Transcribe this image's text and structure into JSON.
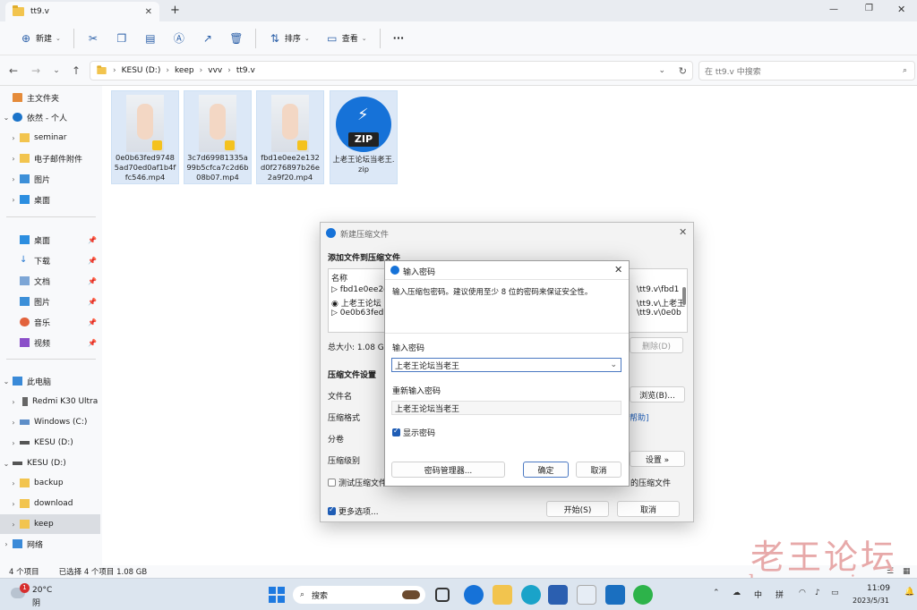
{
  "window": {
    "tab_title": "tt9.v",
    "new_tab": "+",
    "minimize": "—",
    "maximize": "❐",
    "close": "✕"
  },
  "toolbar": {
    "new": "新建",
    "sort": "排序",
    "view": "查看",
    "more": "···"
  },
  "address": {
    "segments": [
      "KESU (D:)",
      "keep",
      "vvv",
      "tt9.v"
    ],
    "search_placeholder": "在 tt9.v 中搜索"
  },
  "sidebar": {
    "home": "主文件夹",
    "onedrive": "依然 - 个人",
    "seminar": "seminar",
    "email": "电子邮件附件",
    "pictures1": "图片",
    "desktop1": "桌面",
    "desktop2": "桌面",
    "downloads": "下载",
    "documents": "文档",
    "pictures2": "图片",
    "music": "音乐",
    "videos": "视频",
    "thispc": "此电脑",
    "redmi": "Redmi K30 Ultra",
    "windows": "Windows (C:)",
    "kesu1": "KESU (D:)",
    "kesu2": "KESU (D:)",
    "backup": "backup",
    "download": "download",
    "keep": "keep",
    "network": "网络"
  },
  "files": [
    {
      "name": "0e0b63fed97485ad70ed0af1b4ffc546.mp4",
      "badge": "Player"
    },
    {
      "name": "3c7d69981335a99b5cfca7c2d6b08b07.mp4",
      "badge": "Player"
    },
    {
      "name": "fbd1e0ee2e132d0f276897b26e2a9f20.mp4",
      "badge": "Player"
    },
    {
      "name": "上老王论坛当老王.zip",
      "badge": "ZIP"
    }
  ],
  "status": {
    "count": "4 个项目",
    "selected": "已选择 4 个项目  1.08 GB"
  },
  "taskbar": {
    "temp": "20°C",
    "weather": "阴",
    "search": "搜索",
    "notif": "1",
    "ime1": "中",
    "ime2": "拼",
    "time": "11:09",
    "date": "2023/5/31"
  },
  "archive_dialog": {
    "title": "新建压缩文件",
    "section_add": "添加文件到压缩文件",
    "col_name": "名称",
    "rows": [
      "fbd1e0ee2e",
      "上老王论坛",
      "0e0b63fed9"
    ],
    "rows_path": [
      "\\tt9.v\\fbd1",
      "\\tt9.v\\上老王",
      "\\tt9.v\\0e0b"
    ],
    "total_size": "总大小: 1.08 GB",
    "delete": "删除(D)",
    "section_settings": "压缩文件设置",
    "filename": "文件名",
    "browse": "浏览(B)...",
    "format": "压缩格式",
    "help": "帮助]",
    "volume": "分卷",
    "level": "压缩级别",
    "adv_settings": "设置 »",
    "test": "测试压缩文件",
    "delete_after": "的压缩文件",
    "more_options": "更多选项...",
    "start": "开始(S)",
    "cancel": "取消"
  },
  "password_dialog": {
    "title": "输入密码",
    "desc": "输入压缩包密码。建议使用至少 8 位的密码来保证安全性。",
    "label_pwd": "输入密码",
    "pwd_value": "上老王论坛当老王",
    "label_repeat": "重新输入密码",
    "repeat_value": "上老王论坛当老王",
    "show_pwd": "显示密码",
    "manager": "密码管理器...",
    "ok": "确定",
    "cancel": "取消"
  },
  "watermark": {
    "cn": "老王论坛",
    "en": "laowang.vip"
  }
}
